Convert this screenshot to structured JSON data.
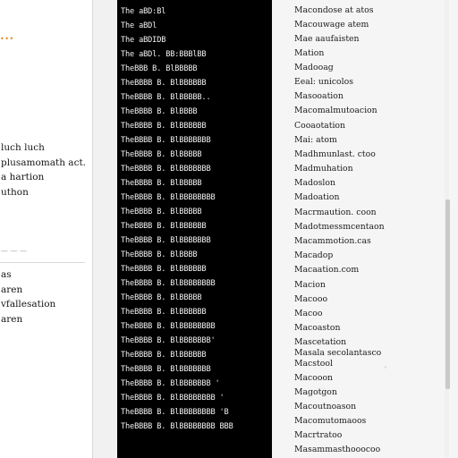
{
  "left": {
    "accent_color": "#e58a1a",
    "accent_text": "• • •",
    "section1": [
      "luch luch",
      "plusamomath act.",
      "a hartion",
      "uthon"
    ],
    "muted": "— — —",
    "section2": [
      "as",
      "aren",
      "vfallesation",
      "aren"
    ]
  },
  "terminal": {
    "lines": [
      "The   aBD:Bl",
      "The   aBDl",
      "The   aBDIDB",
      "The   aBDl. BB:BBBlBB",
      "TheBBB  B.  BlBBBBB",
      "TheBBBB  B.  BlBBBBBB",
      "TheBBBB  B.  BlBBBBB..",
      "TheBBBB  B.  BlBBBB",
      "TheBBBB  B.  BlBBBBBB",
      "TheBBBB  B.  BlBBBBBBB",
      "TheBBBB  B.  BlBBBBB",
      "TheBBBB  B.  BlBBBBBBB",
      "TheBBBB  B.  BlBBBBB",
      "TheBBBB  B.  BlBBBBBBBB",
      "TheBBBB  B.  BlBBBBB",
      "TheBBBB  B.  BlBBBBBB",
      "TheBBBB  B.  BlBBBBBBB",
      "TheBBBB  B.  BlBBBB",
      "TheBBBB  B.  BlBBBBBB",
      "TheBBBB  B.  BlBBBBBBBB",
      "TheBBBB  B.  BlBBBBB",
      "TheBBBB  B.  BlBBBBBB",
      "TheBBBB  B.  BlBBBBBBBB",
      "TheBBBB  B.  BlBBBBBBB'",
      "TheBBBB  B.  BlBBBBBB",
      "TheBBBB  B.  BlBBBBBBB",
      "TheBBBB  B.  BlBBBBBBB  '",
      "TheBBBB  B.  BlBBBBBBBB  '",
      "TheBBBB  B.  BlBBBBBBBB  'B",
      "TheBBBB  B.  BlBBBBBBBB  BBB"
    ]
  },
  "right": {
    "items": [
      "Macondose at atos",
      "Macouwage atem",
      "Mae aaufaisten",
      "Mation",
      "Madooag",
      "Eeal: unicolos",
      "Masooation",
      "Macomalmutoacion",
      "Cooaotation",
      "Mai: atom",
      "Madhmunlast. ctoo",
      "Madmuhation",
      "Madoslon",
      "Madoation",
      "Macrmaution. coon",
      "Madotmessmcentaon",
      "Macammotion.cas",
      "Macadop",
      "Macaation.com",
      "Macion",
      "Macooo",
      "Macoo",
      "Macoaston",
      "Mascetation",
      "Masala secolantasco",
      "Macstool",
      "Macooon",
      "Magotgon",
      "Macoutnoason",
      "Macomutomaoos",
      "Macrtratoo",
      "Masammasthooocoo"
    ],
    "tiny_mark": "'"
  }
}
